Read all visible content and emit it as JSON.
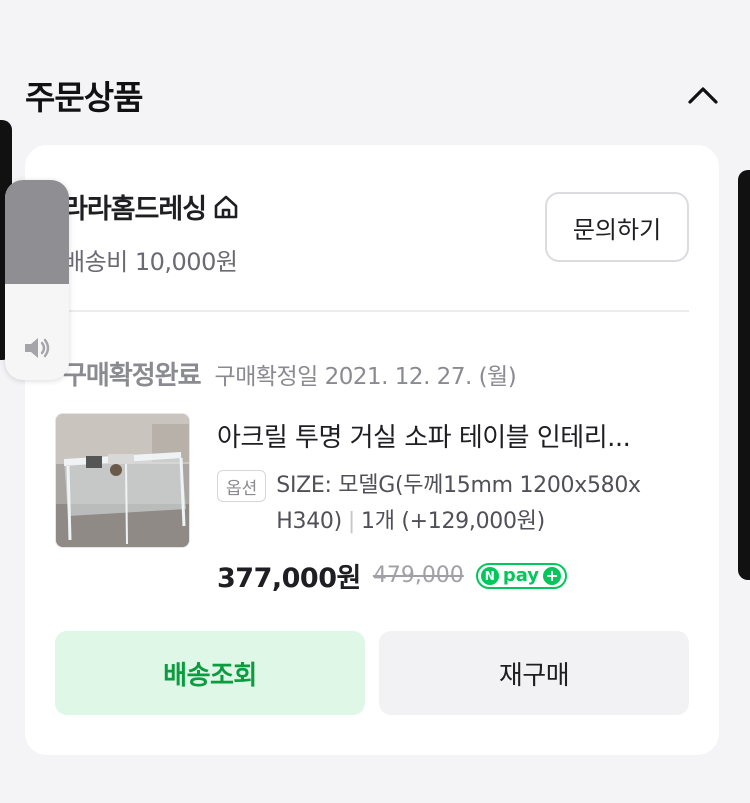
{
  "section": {
    "title": "주문상품"
  },
  "store": {
    "name": "라라홈드레싱",
    "shipping_fee": "배송비 10,000원",
    "inquiry_label": "문의하기"
  },
  "order": {
    "status": "구매확정완료",
    "confirm_date": "구매확정일 2021. 12. 27. (월)"
  },
  "product": {
    "title": "아크릴 투명 거실 소파 테이블 인테리...",
    "option_badge": "옵션",
    "option_size": "SIZE: 모델G(두께15mm 1200x580x H340)",
    "quantity": "1개 (+129,000원)",
    "price": "377,000원",
    "original_price": "479,000",
    "npay_n": "N",
    "npay_label": "pay",
    "npay_plus": "+"
  },
  "actions": {
    "tracking_label": "배송조회",
    "reorder_label": "재구매"
  },
  "volume": {
    "level": 0.35
  },
  "colors": {
    "accent_green": "#03c75a",
    "tracking_bg": "#dff7e6",
    "tracking_text": "#0a9c3f"
  },
  "icons": {
    "collapse": "chevron-up-icon",
    "store": "home-icon",
    "volume": "speaker-icon"
  }
}
